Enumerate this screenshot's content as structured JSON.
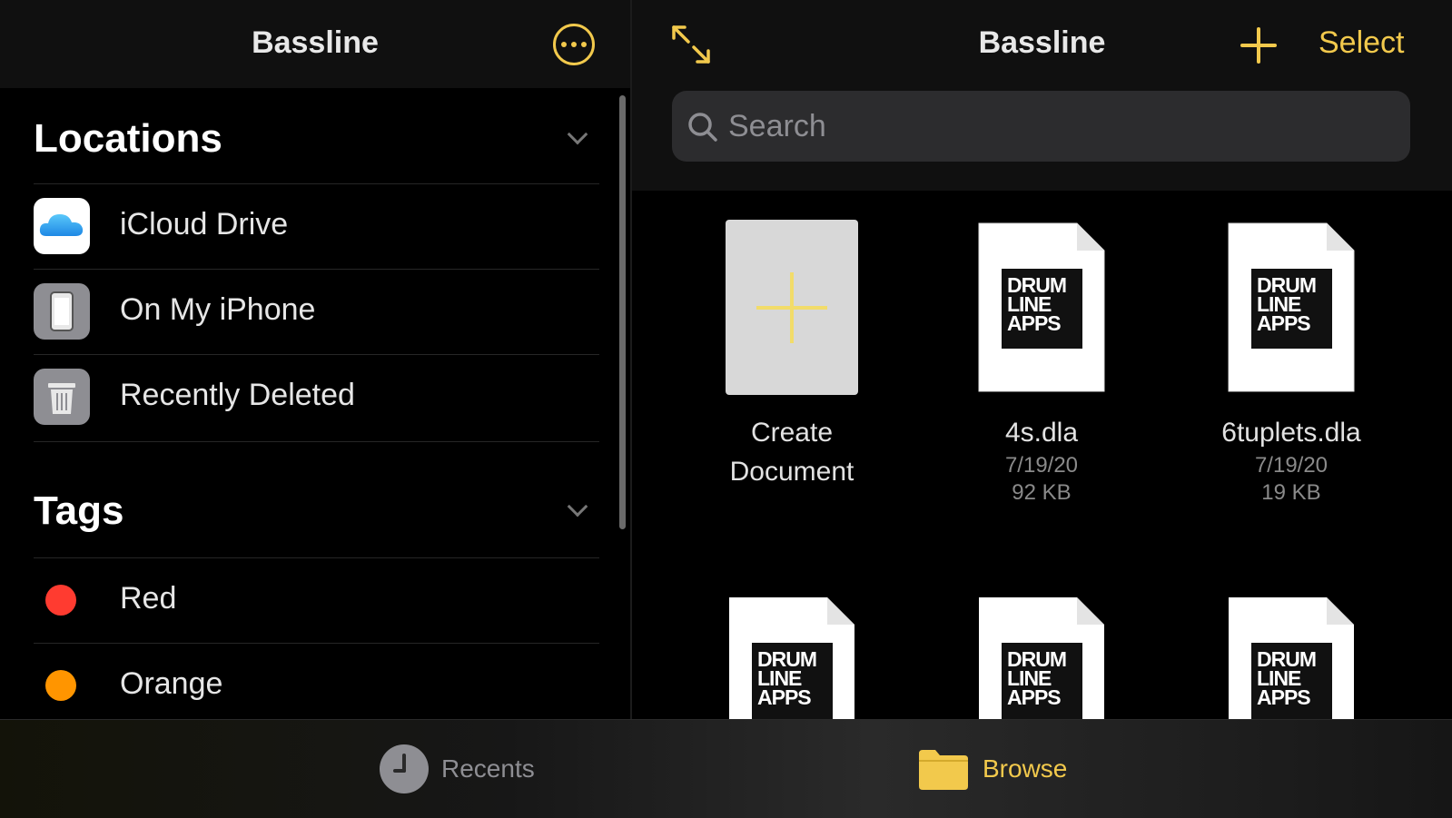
{
  "sidebar": {
    "title": "Bassline",
    "locations_title": "Locations",
    "locations": [
      {
        "label": "iCloud Drive",
        "icon": "icloud-icon"
      },
      {
        "label": "On My iPhone",
        "icon": "iphone-icon"
      },
      {
        "label": "Recently Deleted",
        "icon": "trash-icon"
      }
    ],
    "tags_title": "Tags",
    "tags": [
      {
        "label": "Red",
        "color": "#ff3b30"
      },
      {
        "label": "Orange",
        "color": "#ff9500"
      }
    ]
  },
  "main": {
    "title": "Bassline",
    "select_label": "Select",
    "search_placeholder": "Search",
    "create_label_line1": "Create",
    "create_label_line2": "Document",
    "files": [
      {
        "name": "4s.dla",
        "date": "7/19/20",
        "size": "92 KB"
      },
      {
        "name": "6tuplets.dla",
        "date": "7/19/20",
        "size": "19 KB"
      }
    ],
    "logo_lines": [
      "DRUM",
      "LINE",
      "APPS"
    ]
  },
  "tabbar": {
    "recents_label": "Recents",
    "browse_label": "Browse"
  },
  "colors": {
    "accent": "#f2c94c",
    "inactive": "#8e8e93"
  }
}
